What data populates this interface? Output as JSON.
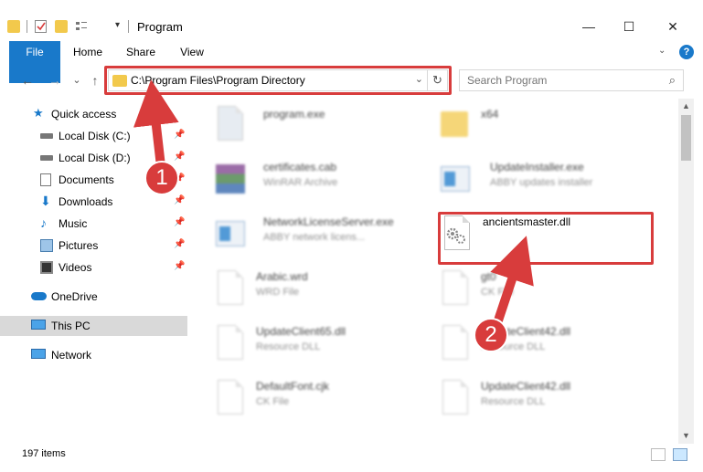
{
  "window": {
    "title": "Program",
    "controls": {
      "minimize": "—",
      "maximize": "☐",
      "close": "✕"
    }
  },
  "ribbon": {
    "tabs": [
      "File",
      "Home",
      "Share",
      "View"
    ],
    "help": "?"
  },
  "navbar": {
    "back": "←",
    "forward": "→",
    "recent": "⌄",
    "up": "↑",
    "address": "C:\\Program Files\\Program Directory",
    "dropdown": "⌄",
    "refresh": "↻",
    "search_placeholder": "Search Program"
  },
  "sidebar": {
    "items": [
      {
        "label": "Quick access",
        "icon": "star-icon",
        "pinned": false
      },
      {
        "label": "Local Disk (C:)",
        "icon": "drive-icon",
        "pinned": true
      },
      {
        "label": "Local Disk (D:)",
        "icon": "drive-icon",
        "pinned": true
      },
      {
        "label": "Documents",
        "icon": "documents-icon",
        "pinned": true
      },
      {
        "label": "Downloads",
        "icon": "download-icon",
        "pinned": true
      },
      {
        "label": "Music",
        "icon": "music-icon",
        "pinned": true
      },
      {
        "label": "Pictures",
        "icon": "pictures-icon",
        "pinned": true
      },
      {
        "label": "Videos",
        "icon": "videos-icon",
        "pinned": true
      },
      {
        "label": "OneDrive",
        "icon": "cloud-icon",
        "pinned": false
      },
      {
        "label": "This PC",
        "icon": "computer-icon",
        "pinned": false
      },
      {
        "label": "Network",
        "icon": "network-icon",
        "pinned": false
      }
    ]
  },
  "files": [
    {
      "name": "program.exe",
      "type": ""
    },
    {
      "name": "x64",
      "type": ""
    },
    {
      "name": "certificates.cab",
      "type": "WinRAR Archive"
    },
    {
      "name": "UpdateInstaller.exe",
      "type": "ABBY updates installer"
    },
    {
      "name": "NetworkLicenseServer.exe",
      "type": "ABBY network licens..."
    },
    {
      "name": "ancientsmaster.dll",
      "type": ""
    },
    {
      "name": "Arabic.wrd",
      "type": "WRD File"
    },
    {
      "name": "gt0",
      "type": "CK File"
    },
    {
      "name": "UpdateClient65.dll",
      "type": "Resource DLL"
    },
    {
      "name": "UpdateClient42.dll",
      "type": "Resource DLL"
    },
    {
      "name": "DefaultFont.cjk",
      "type": "CK File"
    },
    {
      "name": "UpdateClient42.dll",
      "type": "Resource DLL"
    }
  ],
  "status": {
    "count": "197 items"
  },
  "annotations": {
    "step1": "1",
    "step2": "2",
    "color": "#d83c3c"
  }
}
